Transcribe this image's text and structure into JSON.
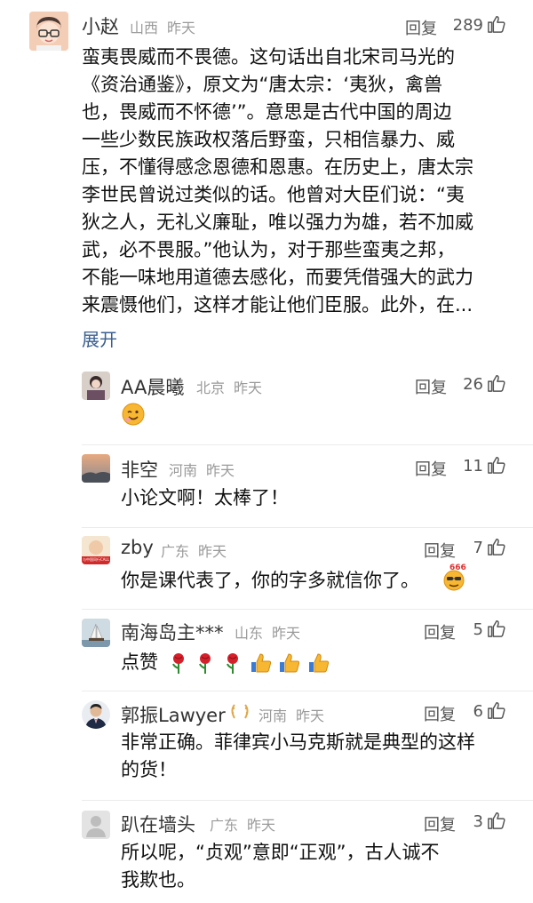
{
  "main": {
    "user": "小赵",
    "location": "山西",
    "time": "昨天",
    "reply_label": "回复",
    "likes": "289",
    "lines": [
      "蛮夷畏威而不畏德。这句话出自北宋司马光的",
      "《资治通鉴》，原文为“唐太宗：‘夷狄，禽兽",
      "也，畏威而不怀德’”。意思是古代中国的周边",
      "一些少数民族政权落后野蛮，只相信暴力、威",
      "压，不懂得感念恩德和恩惠。在历史上，唐太宗",
      "李世民曾说过类似的话。他曾对大臣们说：“夷",
      "狄之人，无礼义廉耻，唯以强力为雄，若不加威",
      "武，必不畏服。”他认为，对于那些蛮夷之邦，",
      "不能一味地用道德去感化，而要凭借强大的武力",
      "来震慑他们，这样才能让他们臣服。此外，在..."
    ],
    "expand_label": "展开"
  },
  "replies": [
    {
      "user": "AA晨曦",
      "location": "北京",
      "time": "昨天",
      "reply_label": "回复",
      "likes": "26",
      "text": ""
    },
    {
      "user": "非空",
      "location": "河南",
      "time": "昨天",
      "reply_label": "回复",
      "likes": "11",
      "text": "小论文啊！太棒了！"
    },
    {
      "user": "zby",
      "location": "广东",
      "time": "昨天",
      "reply_label": "回复",
      "likes": "7",
      "text": "你是课代表了，你的字多就信你了。",
      "avatar_badge": "与中国同行CALL",
      "emoji_badge": "666"
    },
    {
      "user": "南海岛主***",
      "location": "山东",
      "time": "昨天",
      "reply_label": "回复",
      "likes": "5",
      "text": "点赞"
    },
    {
      "user": "郭振Lawyer",
      "location": "河南",
      "time": "昨天",
      "reply_label": "回复",
      "likes": "6",
      "text_lines": [
        "非常正确。菲律宾小马克斯就是典型的这样",
        "的货！"
      ]
    },
    {
      "user": "趴在墙头",
      "location": "广东",
      "time": "昨天",
      "reply_label": "回复",
      "likes": "3",
      "text_lines": [
        "所以呢，“贞观”意即“正观”，古人诚不",
        "我欺也。"
      ]
    }
  ],
  "colors": {
    "meta": "#9a9a9a",
    "expand": "#3a5f8f",
    "separator": "#ececec"
  },
  "icons": [
    "like-thumb-icon",
    "laurel-badge-icon",
    "rose-emoji",
    "thumbs-up-emoji",
    "wink-emoji",
    "cool-666-emoji"
  ]
}
